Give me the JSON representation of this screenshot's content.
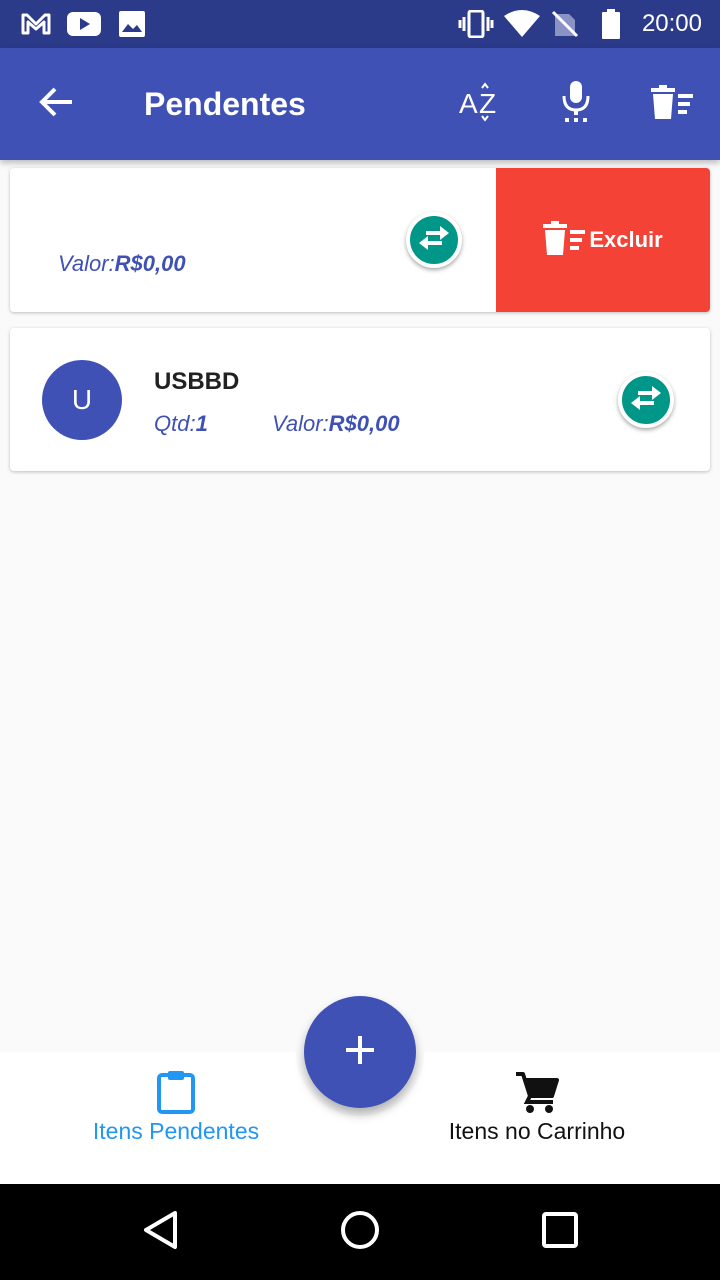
{
  "status_bar": {
    "time": "20:00",
    "icons": [
      "gmail-icon",
      "youtube-icon",
      "gallery-icon",
      "vibrate-icon",
      "wifi-icon",
      "no-signal-icon",
      "battery-icon"
    ]
  },
  "app_bar": {
    "title": "Pendentes",
    "actions": [
      "back-arrow-icon",
      "sort-az-icon",
      "microphone-icon",
      "clear-list-icon"
    ]
  },
  "items": [
    {
      "name": "",
      "valor_label": "Valor:",
      "valor": "R$0,00",
      "swiped": true,
      "delete_label": "Excluir"
    },
    {
      "avatar_letter": "U",
      "name": "USBBD",
      "qtd_label": "Qtd:",
      "qtd": "1",
      "valor_label": "Valor:",
      "valor": "R$0,00"
    }
  ],
  "bottom_nav": {
    "pending_label": "Itens Pendentes",
    "cart_label": "Itens no Carrinho",
    "active_color": "#2196f3"
  },
  "colors": {
    "primary": "#3f51b5",
    "status_bar": "#2c3a8a",
    "accent_teal": "#009688",
    "delete_red": "#f44336"
  }
}
